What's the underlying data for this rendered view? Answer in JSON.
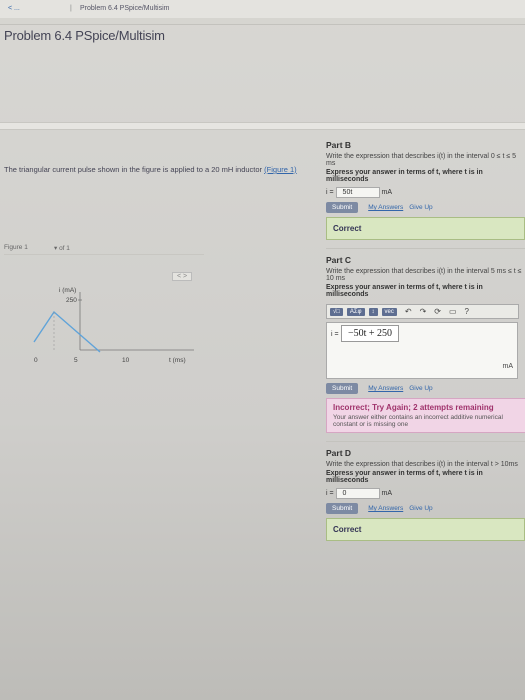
{
  "breadcrumb": {
    "link": "< ...",
    "separator": "|",
    "current": "Problem 6.4 PSpice/Multisim"
  },
  "title": "Problem 6.4 PSpice/Multisim",
  "intro": {
    "text": "The triangular current pulse shown in the figure is applied to a 20 mH inductor",
    "link": "(Figure 1)"
  },
  "figure": {
    "label": "Figure 1",
    "select": "▾ of 1",
    "nav": "< >",
    "y_axis_label": "i (mA)",
    "y_tick": "250",
    "x_ticks": [
      "0",
      "5",
      "10"
    ],
    "x_axis_label": "t (ms)"
  },
  "partB": {
    "title": "Part B",
    "desc": "Write the expression that describes i(t) in the interval 0 ≤ t ≤ 5 ms",
    "instructions": "Express your answer in terms of t, where t is in milliseconds",
    "answer_prefix": "i =",
    "answer_value": "50t",
    "answer_unit": "mA",
    "submit": "Submit",
    "my_answers": "My Answers",
    "give_up": "Give Up",
    "result": "Correct"
  },
  "partC": {
    "title": "Part C",
    "desc": "Write the expression that describes i(t) in the interval 5 ms ≤ t ≤ 10 ms",
    "instructions": "Express your answer in terms of t, where t is in milliseconds",
    "toolbar": {
      "templates": "√□",
      "greek": "AΣφ",
      "brackets": "↕",
      "vec": "vec"
    },
    "answer_prefix": "i =",
    "answer_value": "−50t + 250",
    "answer_unit": "mA",
    "submit": "Submit",
    "my_answers": "My Answers",
    "give_up": "Give Up",
    "incorrect_title": "Incorrect; Try Again; 2 attempts remaining",
    "incorrect_msg": "Your answer either contains an incorrect additive numerical constant or is missing one"
  },
  "partD": {
    "title": "Part D",
    "desc": "Write the expression that describes i(t) in the interval t > 10ms",
    "instructions": "Express your answer in terms of t, where t is in milliseconds",
    "answer_prefix": "i =",
    "answer_value": "0",
    "answer_unit": "mA",
    "submit": "Submit",
    "my_answers": "My Answers",
    "give_up": "Give Up",
    "result": "Correct"
  },
  "colors": {
    "correct_bg": "#d9e7c1",
    "incorrect_bg": "#f1d5e6",
    "incorrect_text": "#a0336c",
    "submit_bg": "#7d8aa3",
    "link": "#3366aa"
  }
}
